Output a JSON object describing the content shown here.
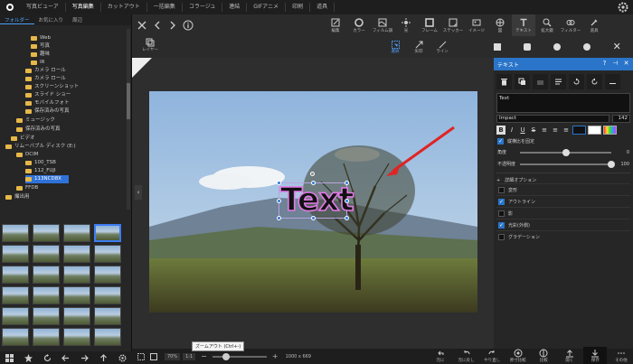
{
  "app": {
    "tabs": [
      "写真ビューア",
      "写真編集",
      "カットアウト",
      "一括編集",
      "コラージュ",
      "連結",
      "GIFアニメ",
      "印刷",
      "道具"
    ],
    "active_tab": 1
  },
  "left_panel": {
    "folder_tabs": [
      "フォルダー",
      "お気に入り",
      "周辺"
    ],
    "tree": [
      {
        "label": "Web"
      },
      {
        "label": "写真"
      },
      {
        "label": "趣味"
      },
      {
        "label": "IR"
      },
      {
        "label": "カメラ ロール"
      },
      {
        "label": "カメラ ロール"
      },
      {
        "label": "スクリーンショット"
      },
      {
        "label": "スライド ショー"
      },
      {
        "label": "モバイルフォト"
      },
      {
        "label": "保存済みの写真"
      },
      {
        "label": "ミュージック"
      },
      {
        "label": "保存済みの写真"
      },
      {
        "label": "ビデオ"
      },
      {
        "label": "リムーバブル ディスク (E:)"
      },
      {
        "label": "DCIM"
      },
      {
        "label": "100_TSB"
      },
      {
        "label": "112_FUJI"
      },
      {
        "label": "113NCD8X"
      },
      {
        "label": "FFDB"
      },
      {
        "label": "撮出用"
      }
    ]
  },
  "toolbar": {
    "buttons": [
      "編集",
      "カラー",
      "フィルム調",
      "光",
      "フレーム",
      "ステッカー",
      "イメージ",
      "図",
      "テキスト",
      "拡大鏡",
      "フィルター",
      "道具"
    ],
    "layer_label": "レイヤー",
    "select_buttons": [
      "選択",
      "矢印",
      "ライン"
    ]
  },
  "text_object": {
    "text": "Text"
  },
  "right_panel": {
    "title": "テキスト",
    "text_value": "Text",
    "font": "Impact",
    "font_size": "142",
    "keep_ratio": "縦横比を固定",
    "angle_label": "角度",
    "angle_value": "0",
    "opacity_label": "不透明度",
    "opacity_value": "100",
    "opacity_level": 1.0,
    "advanced_label": "詳細オプション",
    "options": [
      {
        "label": "変形",
        "checked": false
      },
      {
        "label": "アウトライン",
        "checked": true
      },
      {
        "label": "影",
        "checked": false
      },
      {
        "label": "光彩(外側)",
        "checked": true
      },
      {
        "label": "グラデーション",
        "checked": false
      }
    ]
  },
  "bottom_bar": {
    "zoom": "70%",
    "zoom_1to1": "1:1",
    "zoom_level": 0.7,
    "dimensions": "1000 x 669",
    "tooltip": "ズームアウト (Ctrl+-)",
    "actions": [
      "元に",
      "元に戻し",
      "やり直し",
      "原寸比較",
      "比較",
      "開く",
      "保存",
      "その他"
    ]
  },
  "colors": {
    "accent": "#2a75c9",
    "bg": "#262626",
    "text_outline": "#e27ae7"
  }
}
